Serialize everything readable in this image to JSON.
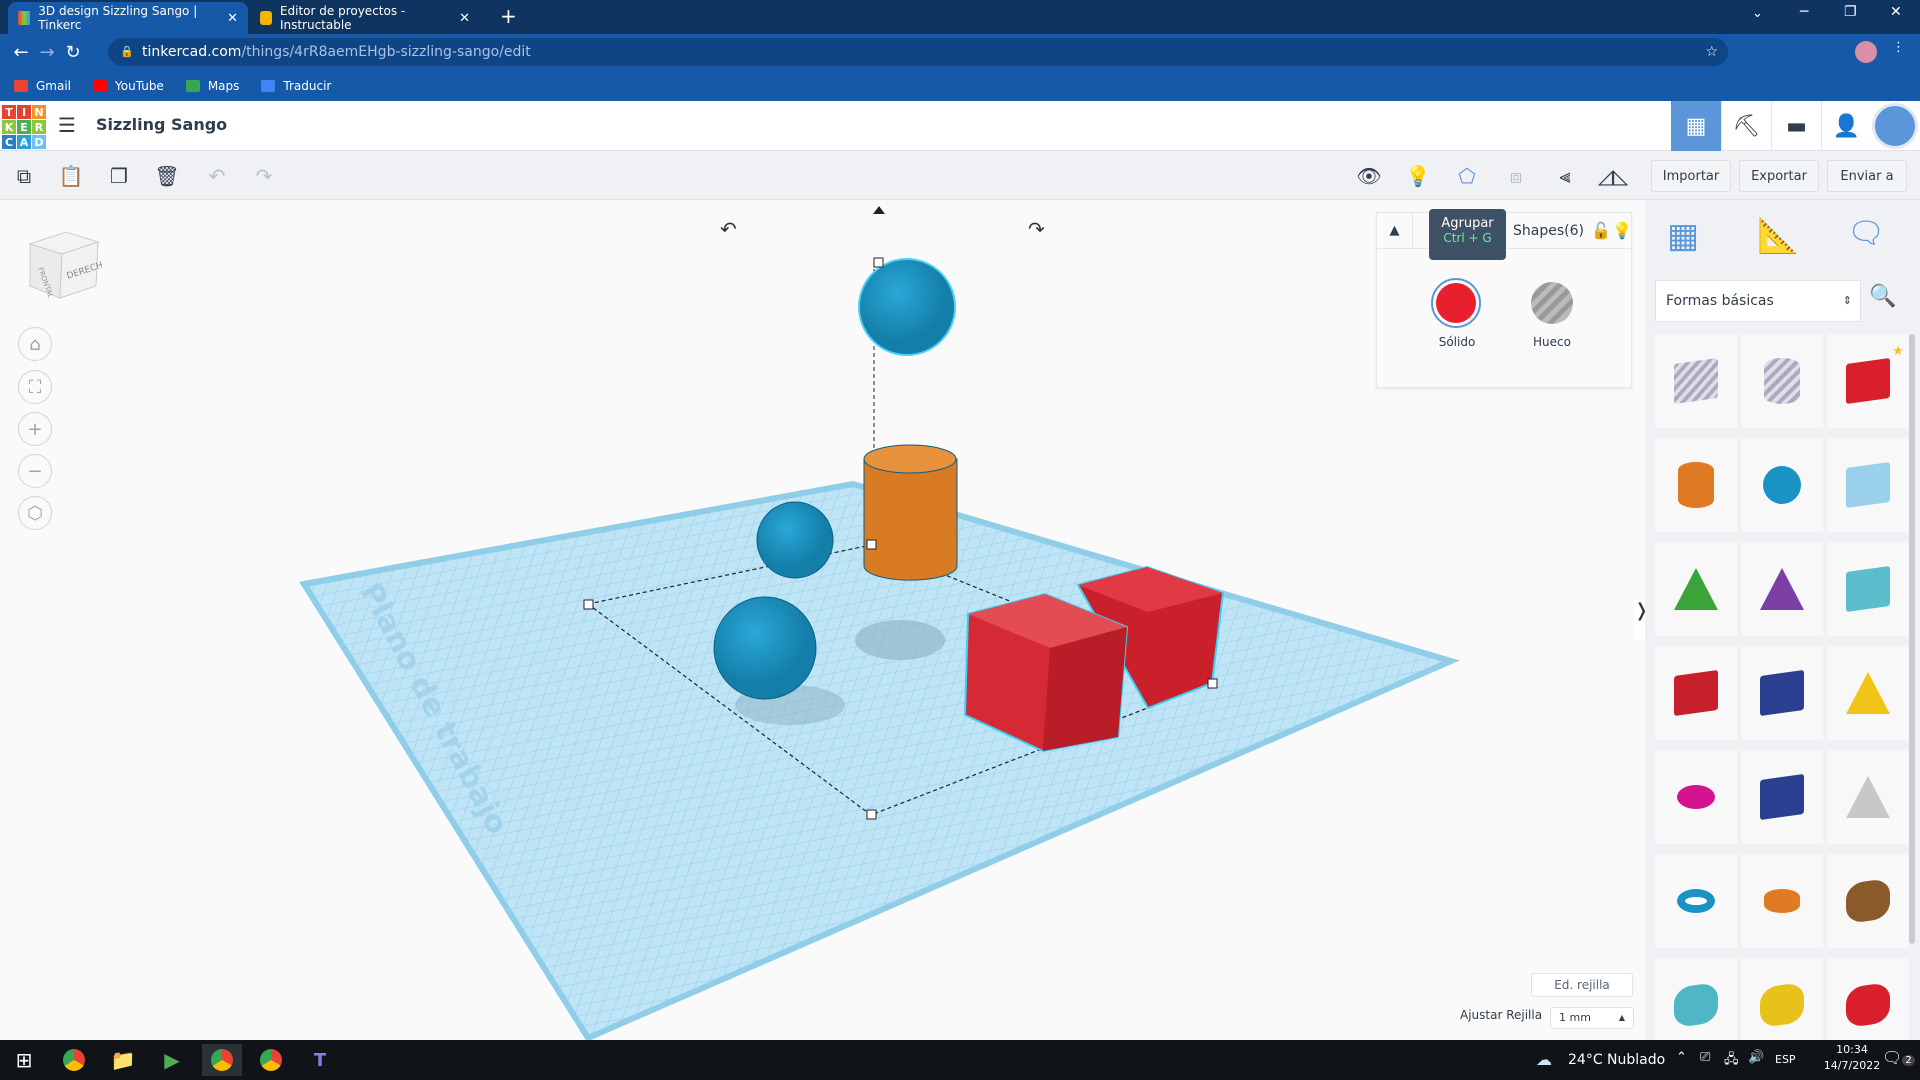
{
  "browser": {
    "tabs": [
      {
        "title": "3D design Sizzling Sango | Tinkerc",
        "active": true
      },
      {
        "title": "Editor de proyectos - Instructable",
        "active": false
      }
    ],
    "url_host": "tinkercad.com",
    "url_path": "/things/4rR8aemEHgb-sizzling-sango/edit",
    "bookmarks": [
      {
        "label": "Gmail",
        "color": "#ea4335"
      },
      {
        "label": "YouTube",
        "color": "#ff0000"
      },
      {
        "label": "Maps",
        "color": "#34a853"
      },
      {
        "label": "Traducir",
        "color": "#4285f4"
      }
    ]
  },
  "app": {
    "logo": [
      "T",
      "I",
      "N",
      "K",
      "E",
      "R",
      "C",
      "A",
      "D"
    ],
    "title": "Sizzling Sango",
    "accent": "#5b96d9"
  },
  "toolbar": {
    "import": "Importar",
    "export": "Exportar",
    "send": "Enviar a"
  },
  "tooltip": {
    "label": "Agrupar",
    "shortcut": "Ctrl + G"
  },
  "inspector": {
    "title": "Shapes(6)",
    "solid": "Sólido",
    "hole": "Hueco",
    "solid_color": "#e8202e"
  },
  "viewcube": {
    "front": "FRONTAL",
    "right": "DERECHA"
  },
  "workplane": {
    "label": "Plano de trabajo",
    "edit_grid": "Ed. rejilla",
    "snap_label": "Ajustar Rejilla",
    "snap_value": "1 mm"
  },
  "library": {
    "category": "Formas básicas",
    "shapes": [
      "Cubo (agujero)",
      "Cilindro (agujero)",
      "Cubo",
      "Cilindro",
      "Esfera",
      "Garabato",
      "Techo",
      "Cono",
      "Techo redondeado",
      "Texto",
      "Prisma",
      "Pirámide",
      "Semiesfera",
      "Polígono",
      "Paraboloide",
      "Toroide",
      "Tubo",
      "Corazón",
      "Estrella",
      "Estrella",
      "Icosaedro"
    ]
  },
  "taskbar": {
    "weather": "24°C  Nublado",
    "lang": "ESP",
    "time": "10:34",
    "date": "14/7/2022",
    "notifications": "2"
  }
}
